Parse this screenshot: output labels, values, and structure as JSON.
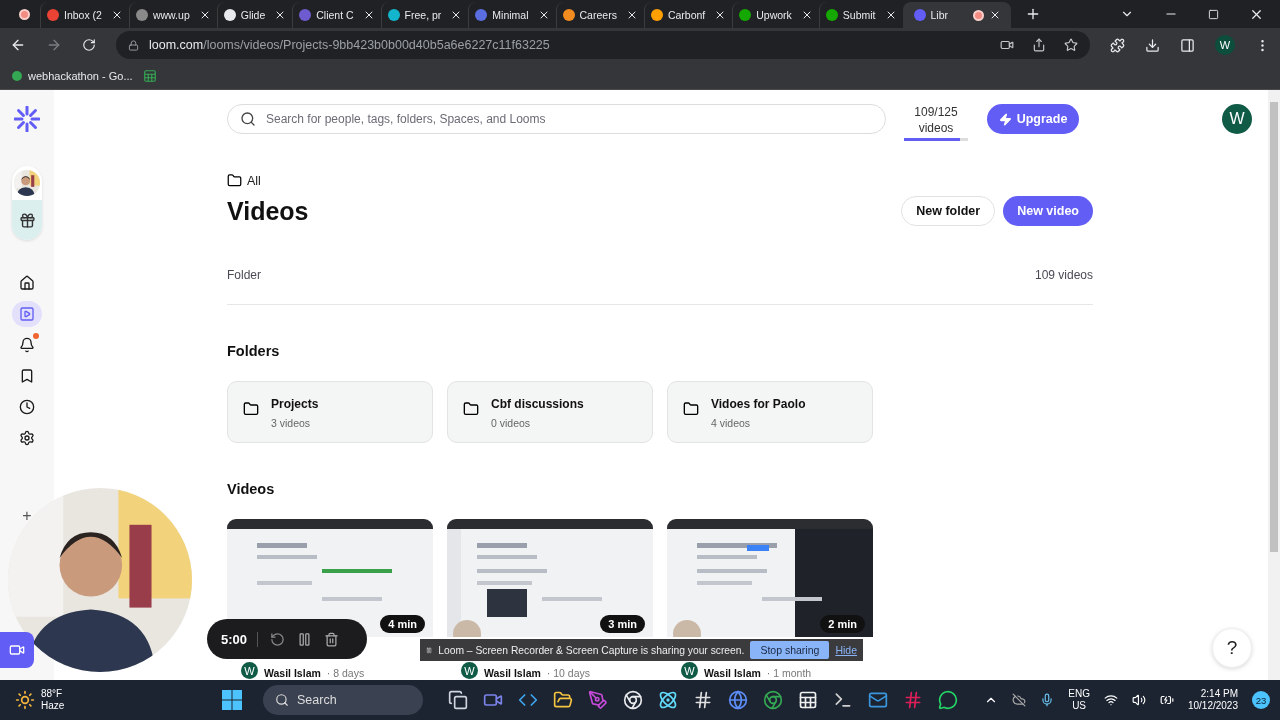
{
  "browser": {
    "tabs": [
      {
        "title": "Inbox (2",
        "color": "#ea4335",
        "selected": false,
        "recording": false
      },
      {
        "title": "www.up",
        "color": "#8a8a8a",
        "selected": false,
        "recording": false
      },
      {
        "title": "Glide",
        "color": "#e8eaed",
        "selected": false,
        "recording": false
      },
      {
        "title": "Client C",
        "color": "#6f5bd0",
        "selected": false,
        "recording": false
      },
      {
        "title": "Free, pr",
        "color": "#12b5cb",
        "selected": false,
        "recording": false
      },
      {
        "title": "Minimal",
        "color": "#5b6ee1",
        "selected": false,
        "recording": false
      },
      {
        "title": "Careers",
        "color": "#f28b20",
        "selected": false,
        "recording": false
      },
      {
        "title": "Carbonf",
        "color": "#ffa000",
        "selected": false,
        "recording": false
      },
      {
        "title": "Upwork",
        "color": "#14a800",
        "selected": false,
        "recording": false
      },
      {
        "title": "Submit",
        "color": "#14a800",
        "selected": false,
        "recording": false
      },
      {
        "title": "Libr",
        "color": "#625df5",
        "selected": true,
        "recording": true
      }
    ],
    "address": {
      "host": "loom.com",
      "path": "/looms/videos/Projects-9bb423b0b00d40b5a6e6227c11f63225"
    },
    "profile": "W",
    "bookmarks": [
      {
        "title": "webhackathon - Go..."
      }
    ]
  },
  "sidebar": {
    "items": [
      {
        "kind": "home",
        "selected": false,
        "unread": false
      },
      {
        "kind": "library",
        "selected": true,
        "unread": false
      },
      {
        "kind": "notifications",
        "selected": false,
        "unread": true
      },
      {
        "kind": "bookmarks",
        "selected": false,
        "unread": false
      },
      {
        "kind": "history",
        "selected": false,
        "unread": false
      },
      {
        "kind": "settings",
        "selected": false,
        "unread": false
      }
    ],
    "add": "+"
  },
  "topbar": {
    "search": {
      "placeholder": "Search for people, tags, folders, Spaces, and Looms"
    },
    "usage": {
      "count": "109/125",
      "unit": "videos",
      "level": 0.87
    },
    "upgrade": "Upgrade",
    "avatar": "W"
  },
  "breadcrumb": "All",
  "title": "Videos",
  "actions": [
    "New folder",
    "New video"
  ],
  "filter": {
    "label": "Folder",
    "count": "109 videos"
  },
  "folders_heading": "Folders",
  "folders": [
    {
      "name": "Projects",
      "count": "3 videos"
    },
    {
      "name": "Cbf discussions",
      "count": "0 videos"
    },
    {
      "name": "Vidoes for Paolo",
      "count": "4 videos"
    }
  ],
  "videos_heading": "Videos",
  "videos": [
    {
      "duration": "4 min",
      "avatar": "W",
      "author": "Wasil Islam",
      "age": "· 8 days"
    },
    {
      "duration": "3 min",
      "avatar": "W",
      "author": "Wasil Islam",
      "age": "· 10 days"
    },
    {
      "duration": "2 min",
      "avatar": "W",
      "author": "Wasil Islam",
      "age": "· 1 month"
    }
  ],
  "recorder": {
    "timer": "5:00"
  },
  "share_notice": {
    "message": "Loom – Screen Recorder & Screen Capture is sharing your screen.",
    "stop": "Stop sharing",
    "hide": "Hide"
  },
  "help": "?",
  "taskbar": {
    "weather": {
      "temp": "88°F",
      "condition": "Haze"
    },
    "search": "Search",
    "language": [
      "ENG",
      "US"
    ],
    "time": "2:14 PM",
    "date": "10/12/2023",
    "notifications": "23"
  }
}
